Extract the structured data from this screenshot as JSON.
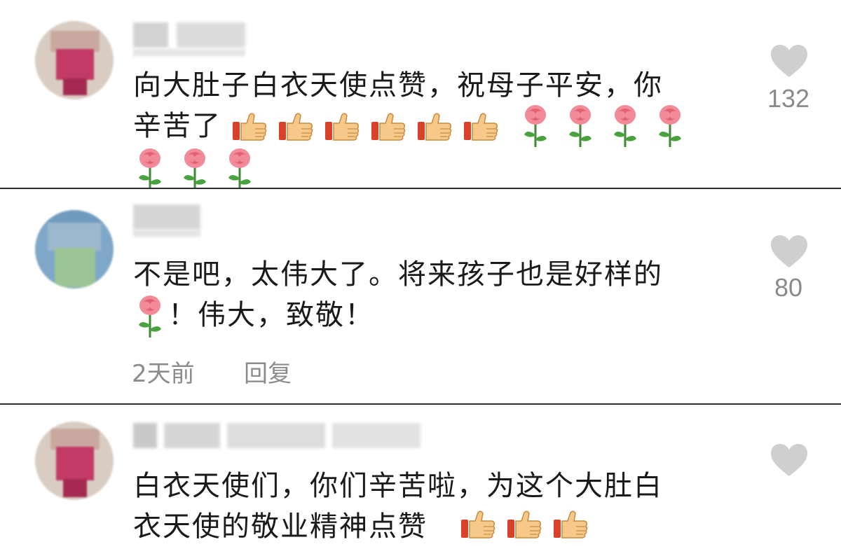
{
  "colors": {
    "heart": "#cfcfcf",
    "count": "#8a8a8a",
    "text": "#1a1a1a",
    "meta": "#8c8c8c"
  },
  "comments": [
    {
      "text_line1": "向大肚子白衣天使点赞，祝母子平安，你",
      "text_line2": "辛苦了",
      "emojis": [
        "thumbs-up",
        "thumbs-up",
        "thumbs-up",
        "thumbs-up",
        "thumbs-up",
        "thumbs-up",
        "rose",
        "rose",
        "rose",
        "rose",
        "rose",
        "rose",
        "rose"
      ],
      "likes": "132"
    },
    {
      "text_line1": "不是吧，太伟大了。将来孩子也是好样的",
      "text_line2": "！伟大，致敬！",
      "emojis": [
        "rose"
      ],
      "likes": "80",
      "time": "2天前",
      "reply": "回复"
    },
    {
      "text_line1": "白衣天使们，你们辛苦啦，为这个大肚白",
      "text_line2": "衣天使的敬业精神点赞",
      "emojis": [
        "thumbs-up",
        "thumbs-up",
        "thumbs-up"
      ]
    }
  ]
}
